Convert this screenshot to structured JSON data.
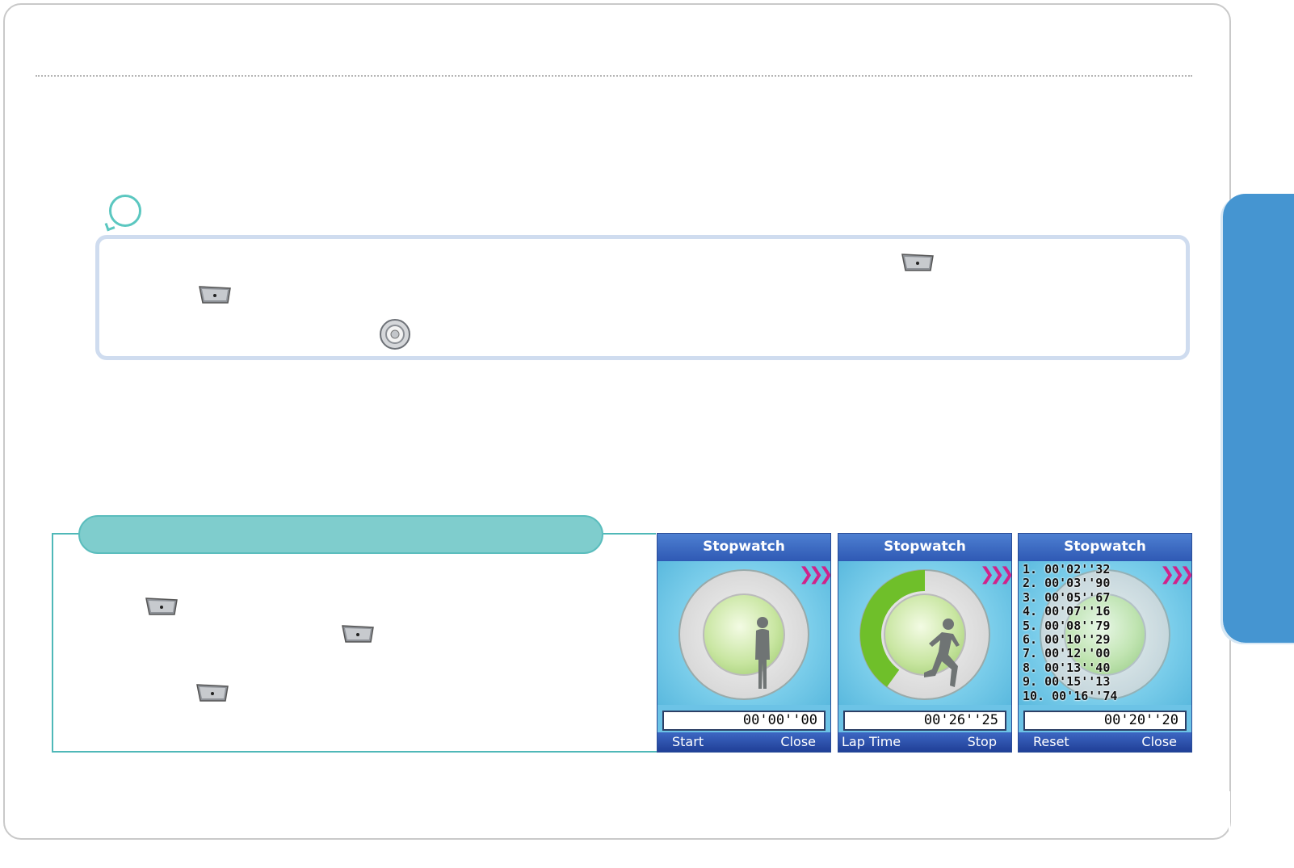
{
  "colors": {
    "side_tab": "#4595d1",
    "note_border": "#cfdcef",
    "section_pill": "#7fcdcd",
    "screen_title_bar": "#2f59b4",
    "progress_green": "#6fbf2a"
  },
  "icons": {
    "softkey": "softkey-button-icon",
    "nav": "navigation-key-icon",
    "note": "note-bubble-icon"
  },
  "screens": [
    {
      "title": "Stopwatch",
      "time": "00'00''00",
      "left_softkey": "Start",
      "right_softkey": "Close",
      "progress": 0,
      "figure": "standing-figure"
    },
    {
      "title": "Stopwatch",
      "time": "00'26''25",
      "left_softkey": "Lap Time",
      "right_softkey": "Stop",
      "progress": 0.4,
      "figure": "running-figure"
    },
    {
      "title": "Stopwatch",
      "time": "00'20''20",
      "left_softkey": "Reset",
      "right_softkey": "Close",
      "laps": [
        "1. 00'02''32",
        "2. 00'03''90",
        "3. 00'05''67",
        "4. 00'07''16",
        "5. 00'08''79",
        "6. 00'10''29",
        "7. 00'12''00",
        "8. 00'13''40",
        "9. 00'15''13",
        "10. 00'16''74"
      ]
    }
  ]
}
